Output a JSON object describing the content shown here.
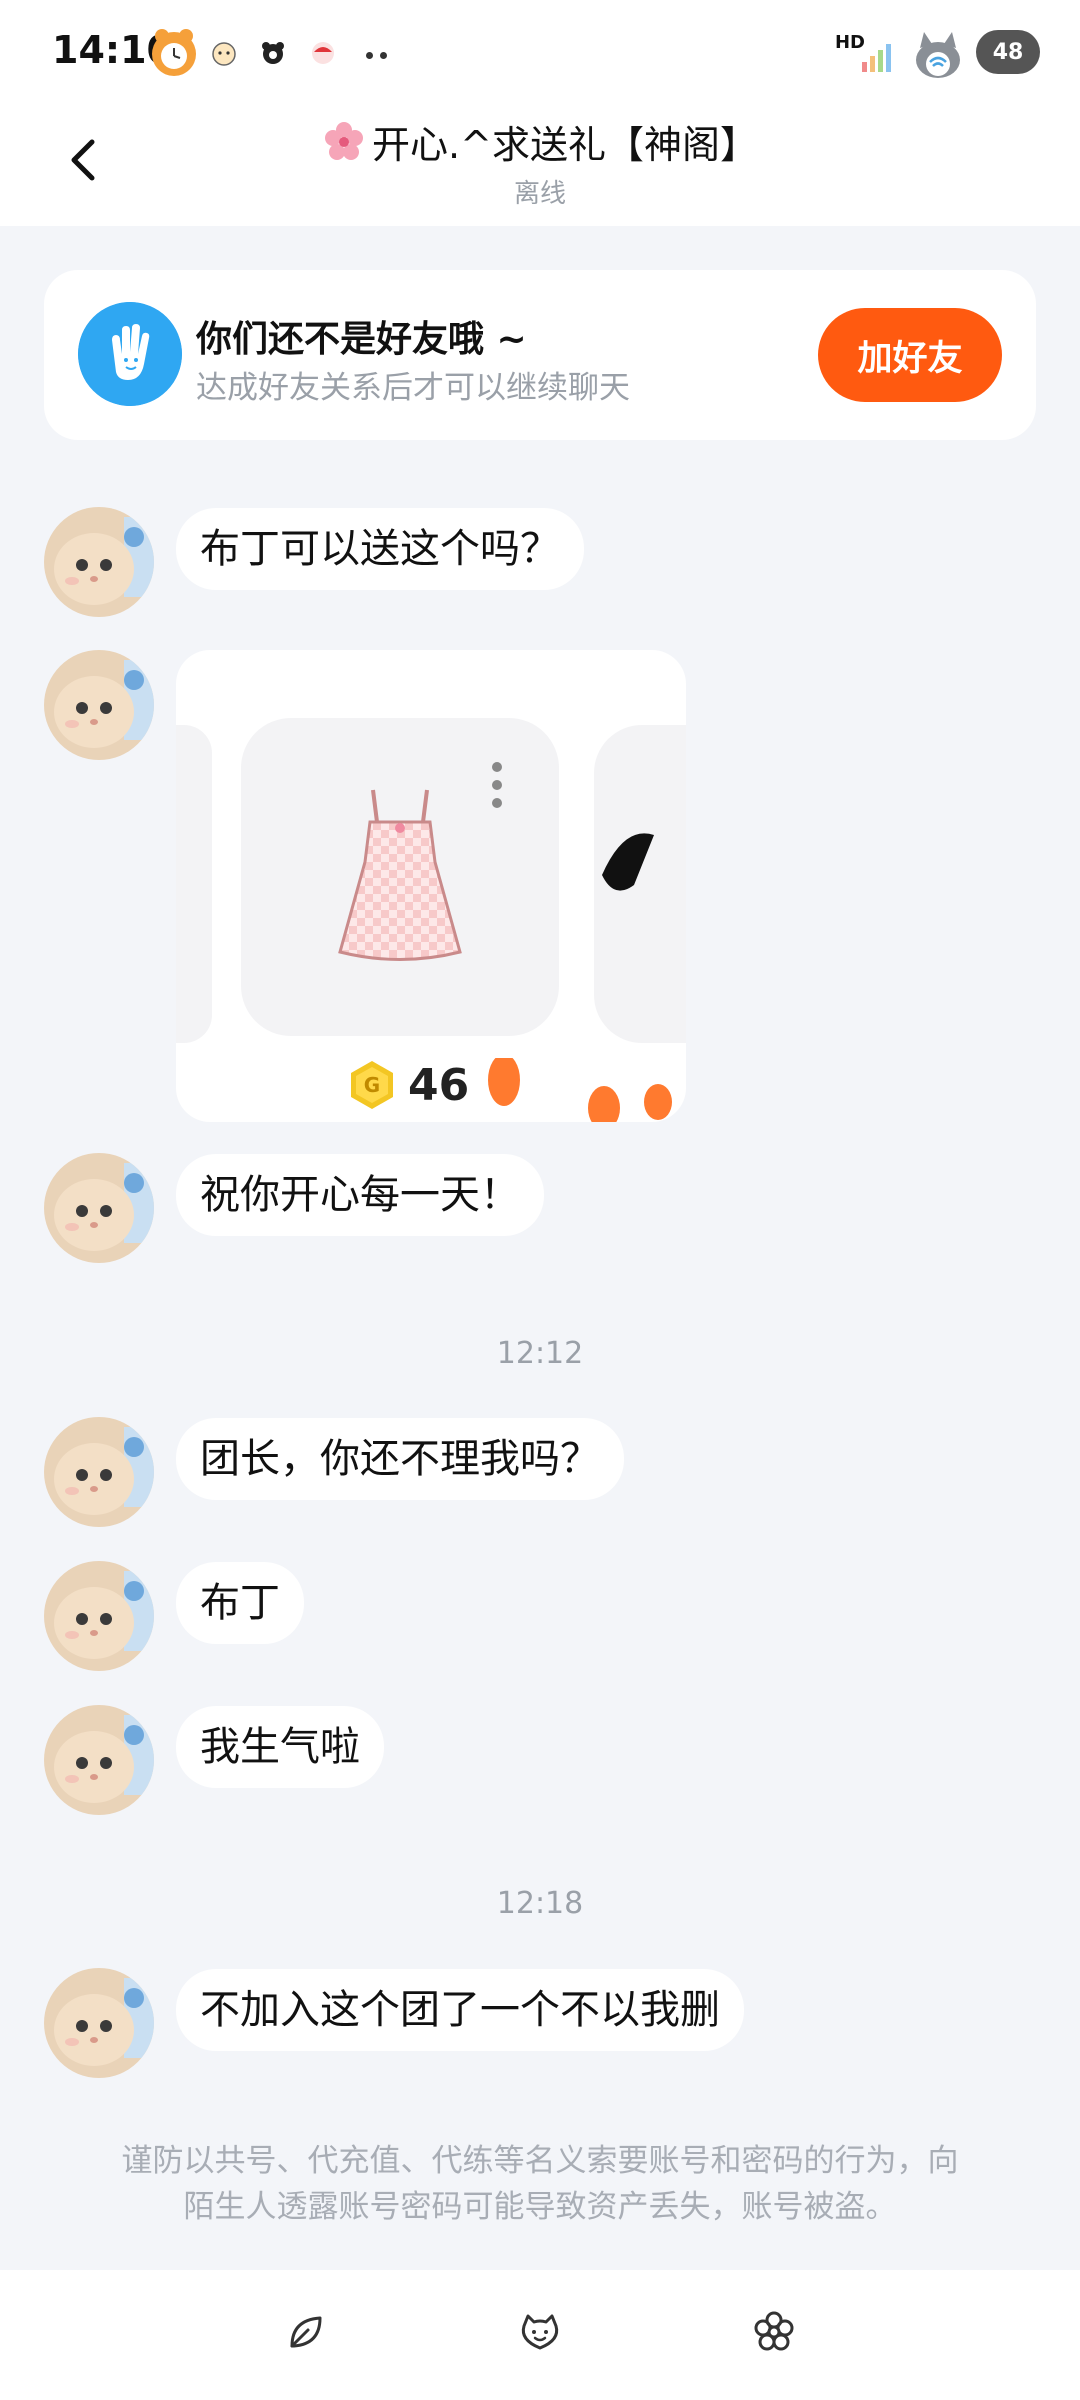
{
  "status_bar": {
    "time": "14:10",
    "hd_label": "HD",
    "battery_level": "48"
  },
  "header": {
    "title": "开心.^求送礼【神阁】",
    "status": "离线",
    "back_icon": "chevron-left-icon"
  },
  "friend_banner": {
    "title": "你们还不是好友哦 ~",
    "subtitle": "达成好友关系后才可以继续聊天",
    "button_label": "加好友",
    "accent_color": "#ff5a10"
  },
  "messages": [
    {
      "type": "text",
      "text": "布丁可以送这个吗？"
    },
    {
      "type": "gift_card",
      "price": "46"
    },
    {
      "type": "text",
      "text": "祝你开心每一天！"
    },
    {
      "type": "timestamp",
      "text": "12:12"
    },
    {
      "type": "text",
      "text": "团长，你还不理我吗？"
    },
    {
      "type": "text",
      "text": "布丁"
    },
    {
      "type": "text",
      "text": "我生气啦"
    },
    {
      "type": "timestamp",
      "text": "12:18"
    },
    {
      "type": "text",
      "text": "不加入这个团了一个不以我删"
    }
  ],
  "safety_notice": {
    "line1": "谨防以共号、代充值、代练等名义索要账号和密码的行为，向",
    "line2": "陌生人透露账号密码可能导致资产丢失，账号被盗。"
  },
  "bottom_bar": {
    "icons": [
      "leaf-icon",
      "smiley-face-icon",
      "flower-icon"
    ]
  }
}
